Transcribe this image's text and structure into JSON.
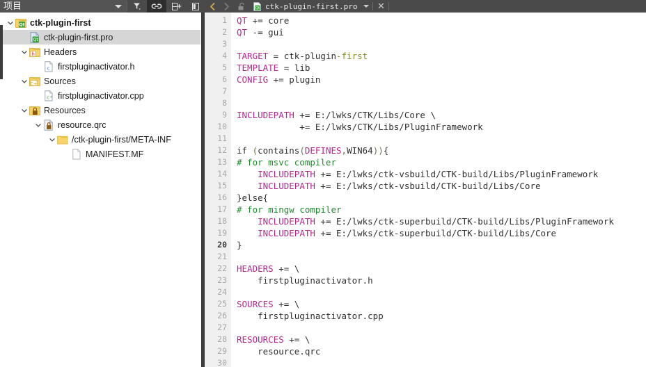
{
  "topbar": {
    "project_combo_label": "项目",
    "combo_tooltip": "project-selector",
    "filter_icon": "filter-icon",
    "link_icon": "link-icon",
    "split_icon": "split-add-icon",
    "sidebar_icon": "toggle-sidebar-icon",
    "back_icon": "back-arrow-icon",
    "forward_icon": "forward-arrow-icon",
    "lock_icon": "unlock-icon",
    "tab_label": "ctk-plugin-first.pro",
    "tab_file_icon": "qt-pro-file-icon",
    "tab_dropdown_icon": "chevron-down-icon",
    "close_label": "✕"
  },
  "sidebar": {
    "items": [
      {
        "label": "ctk-plugin-first",
        "indent": 0,
        "arrow": "down",
        "icon": "qt-project-icon",
        "bold": true,
        "selected": false
      },
      {
        "label": "ctk-plugin-first.pro",
        "indent": 1,
        "arrow": "none",
        "icon": "qt-pro-file-icon",
        "bold": false,
        "selected": true
      },
      {
        "label": "Headers",
        "indent": 1,
        "arrow": "down",
        "icon": "headers-folder-icon",
        "bold": false,
        "selected": false
      },
      {
        "label": "firstpluginactivator.h",
        "indent": 2,
        "arrow": "none",
        "icon": "h-file-icon",
        "bold": false,
        "selected": false
      },
      {
        "label": "Sources",
        "indent": 1,
        "arrow": "down",
        "icon": "sources-folder-icon",
        "bold": false,
        "selected": false
      },
      {
        "label": "firstpluginactivator.cpp",
        "indent": 2,
        "arrow": "none",
        "icon": "cpp-file-icon",
        "bold": false,
        "selected": false
      },
      {
        "label": "Resources",
        "indent": 1,
        "arrow": "down",
        "icon": "resources-folder-icon",
        "bold": false,
        "selected": false
      },
      {
        "label": "resource.qrc",
        "indent": 2,
        "arrow": "down",
        "icon": "qrc-file-icon",
        "bold": false,
        "selected": false
      },
      {
        "label": "/ctk-plugin-first/META-INF",
        "indent": 3,
        "arrow": "down",
        "icon": "folder-icon",
        "bold": false,
        "selected": false
      },
      {
        "label": "MANIFEST.MF",
        "indent": 4,
        "arrow": "none",
        "icon": "plain-file-icon",
        "bold": false,
        "selected": false
      }
    ]
  },
  "editor": {
    "cursor_line": 20,
    "first_line": 1,
    "last_line": 30,
    "lines": [
      {
        "n": 1,
        "tokens": [
          {
            "t": "QT",
            "c": "kw"
          },
          {
            "t": " += ",
            "c": "txt"
          },
          {
            "t": "core",
            "c": "txt"
          }
        ]
      },
      {
        "n": 2,
        "tokens": [
          {
            "t": "QT",
            "c": "kw"
          },
          {
            "t": " -= ",
            "c": "txt"
          },
          {
            "t": "gui",
            "c": "txt"
          }
        ]
      },
      {
        "n": 3,
        "tokens": []
      },
      {
        "n": 4,
        "tokens": [
          {
            "t": "TARGET",
            "c": "kw"
          },
          {
            "t": " = ",
            "c": "txt"
          },
          {
            "t": "ctk-plugin",
            "c": "txt"
          },
          {
            "t": "-first",
            "c": "olive"
          }
        ]
      },
      {
        "n": 5,
        "tokens": [
          {
            "t": "TEMPLATE",
            "c": "kw"
          },
          {
            "t": " = ",
            "c": "txt"
          },
          {
            "t": "lib",
            "c": "txt"
          }
        ]
      },
      {
        "n": 6,
        "tokens": [
          {
            "t": "CONFIG",
            "c": "kw"
          },
          {
            "t": " += ",
            "c": "txt"
          },
          {
            "t": "plugin",
            "c": "txt"
          }
        ]
      },
      {
        "n": 7,
        "tokens": []
      },
      {
        "n": 8,
        "tokens": []
      },
      {
        "n": 9,
        "tokens": [
          {
            "t": "INCLUDEPATH",
            "c": "kw"
          },
          {
            "t": " += E:/lwks/CTK/Libs/Core \\",
            "c": "txt"
          }
        ]
      },
      {
        "n": 10,
        "tokens": [
          {
            "t": "            += E:/lwks/CTK/Libs/PluginFramework",
            "c": "txt"
          }
        ]
      },
      {
        "n": 11,
        "tokens": []
      },
      {
        "n": 12,
        "tokens": [
          {
            "t": "if ",
            "c": "txt"
          },
          {
            "t": "(",
            "c": "op"
          },
          {
            "t": "contains",
            "c": "txt"
          },
          {
            "t": "(",
            "c": "op"
          },
          {
            "t": "DEFINES",
            "c": "kw"
          },
          {
            "t": ",",
            "c": "op"
          },
          {
            "t": "WIN64",
            "c": "txt"
          },
          {
            "t": ")",
            "c": "op"
          },
          {
            "t": ")",
            "c": "op"
          },
          {
            "t": "{",
            "c": "txt"
          }
        ]
      },
      {
        "n": 13,
        "tokens": [
          {
            "t": "# for msvc compiler",
            "c": "cmt"
          }
        ]
      },
      {
        "n": 14,
        "tokens": [
          {
            "t": "    ",
            "c": "txt"
          },
          {
            "t": "INCLUDEPATH",
            "c": "kw"
          },
          {
            "t": " += E:/lwks/ctk-vsbuild/CTK-build/Libs/PluginFramework",
            "c": "txt"
          }
        ]
      },
      {
        "n": 15,
        "tokens": [
          {
            "t": "    ",
            "c": "txt"
          },
          {
            "t": "INCLUDEPATH",
            "c": "kw"
          },
          {
            "t": " += E:/lwks/ctk-vsbuild/CTK-build/Libs/Core",
            "c": "txt"
          }
        ]
      },
      {
        "n": 16,
        "tokens": [
          {
            "t": "}else{",
            "c": "txt"
          }
        ]
      },
      {
        "n": 17,
        "tokens": [
          {
            "t": "# for mingw compiler",
            "c": "cmt"
          }
        ]
      },
      {
        "n": 18,
        "tokens": [
          {
            "t": "    ",
            "c": "txt"
          },
          {
            "t": "INCLUDEPATH",
            "c": "kw"
          },
          {
            "t": " += E:/lwks/ctk-superbuild/CTK-build/Libs/PluginFramework",
            "c": "txt"
          }
        ]
      },
      {
        "n": 19,
        "tokens": [
          {
            "t": "    ",
            "c": "txt"
          },
          {
            "t": "INCLUDEPATH",
            "c": "kw"
          },
          {
            "t": " += E:/lwks/ctk-superbuild/CTK-build/Libs/Core",
            "c": "txt"
          }
        ]
      },
      {
        "n": 20,
        "tokens": [
          {
            "t": "}",
            "c": "txt"
          }
        ]
      },
      {
        "n": 21,
        "tokens": []
      },
      {
        "n": 22,
        "tokens": [
          {
            "t": "HEADERS",
            "c": "kw"
          },
          {
            "t": " += \\",
            "c": "txt"
          }
        ]
      },
      {
        "n": 23,
        "tokens": [
          {
            "t": "    firstpluginactivator.h",
            "c": "txt"
          }
        ]
      },
      {
        "n": 24,
        "tokens": []
      },
      {
        "n": 25,
        "tokens": [
          {
            "t": "SOURCES",
            "c": "kw"
          },
          {
            "t": " += \\",
            "c": "txt"
          }
        ]
      },
      {
        "n": 26,
        "tokens": [
          {
            "t": "    firstpluginactivator.cpp",
            "c": "txt"
          }
        ]
      },
      {
        "n": 27,
        "tokens": []
      },
      {
        "n": 28,
        "tokens": [
          {
            "t": "RESOURCES",
            "c": "kw"
          },
          {
            "t": " += \\",
            "c": "txt"
          }
        ]
      },
      {
        "n": 29,
        "tokens": [
          {
            "t": "    resource.qrc",
            "c": "txt"
          }
        ]
      },
      {
        "n": 30,
        "tokens": []
      }
    ]
  },
  "colors": {
    "keyword": "#b5278f",
    "comment": "#1e8b2e",
    "text": "#303030",
    "gutter_bg": "#f0f0f0",
    "gutter_fg": "#a8a8a8",
    "topbar_bg": "#4a4a4a",
    "selection_bg": "#d6d6d6",
    "accent_yellow": "#f2c94c"
  }
}
